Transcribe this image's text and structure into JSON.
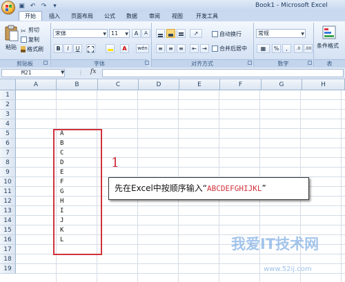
{
  "window": {
    "title": "Book1 - Microsoft Excel"
  },
  "tabs": [
    "开始",
    "插入",
    "页面布局",
    "公式",
    "数据",
    "审阅",
    "视图",
    "开发工具"
  ],
  "active_tab": "开始",
  "ribbon": {
    "clipboard": {
      "paste": "粘贴",
      "cut": "剪切",
      "copy": "复制",
      "format_painter": "格式刷",
      "group": "剪贴板"
    },
    "font": {
      "name": "宋体",
      "size": "11",
      "grow": "A",
      "shrink": "A",
      "bold": "B",
      "italic": "I",
      "underline": "U",
      "wen": "wén",
      "group": "字体"
    },
    "alignment": {
      "wrap": "自动换行",
      "merge": "合并后居中",
      "group": "对齐方式"
    },
    "number": {
      "format": "常规",
      "currency": "%",
      "comma": ",",
      "group": "数字"
    },
    "styles": {
      "conditional": "条件格式",
      "group": "表"
    }
  },
  "formula_bar": {
    "name_box": "M21",
    "fx": "fx",
    "value": ""
  },
  "columns": [
    "A",
    "B",
    "C",
    "D",
    "E",
    "F",
    "G",
    "H"
  ],
  "rows": [
    "1",
    "2",
    "3",
    "4",
    "5",
    "6",
    "7",
    "8",
    "9",
    "10",
    "11",
    "12",
    "13",
    "14",
    "15",
    "16",
    "17",
    "18",
    "19"
  ],
  "cells_b": [
    "A",
    "B",
    "C",
    "D",
    "E",
    "F",
    "G",
    "H",
    "I",
    "J",
    "K",
    "L"
  ],
  "annotation": {
    "number": "1",
    "text_prefix": "先在Excel中按顺序输入“",
    "text_highlight": "ABCDEFGHIJKL",
    "text_suffix": "”"
  },
  "watermark": {
    "text": "我爱IT技术网",
    "url": "www.52ij.com"
  },
  "colors": {
    "accent_red": "#d0303a",
    "ribbon_blue": "#c9d9ef"
  }
}
